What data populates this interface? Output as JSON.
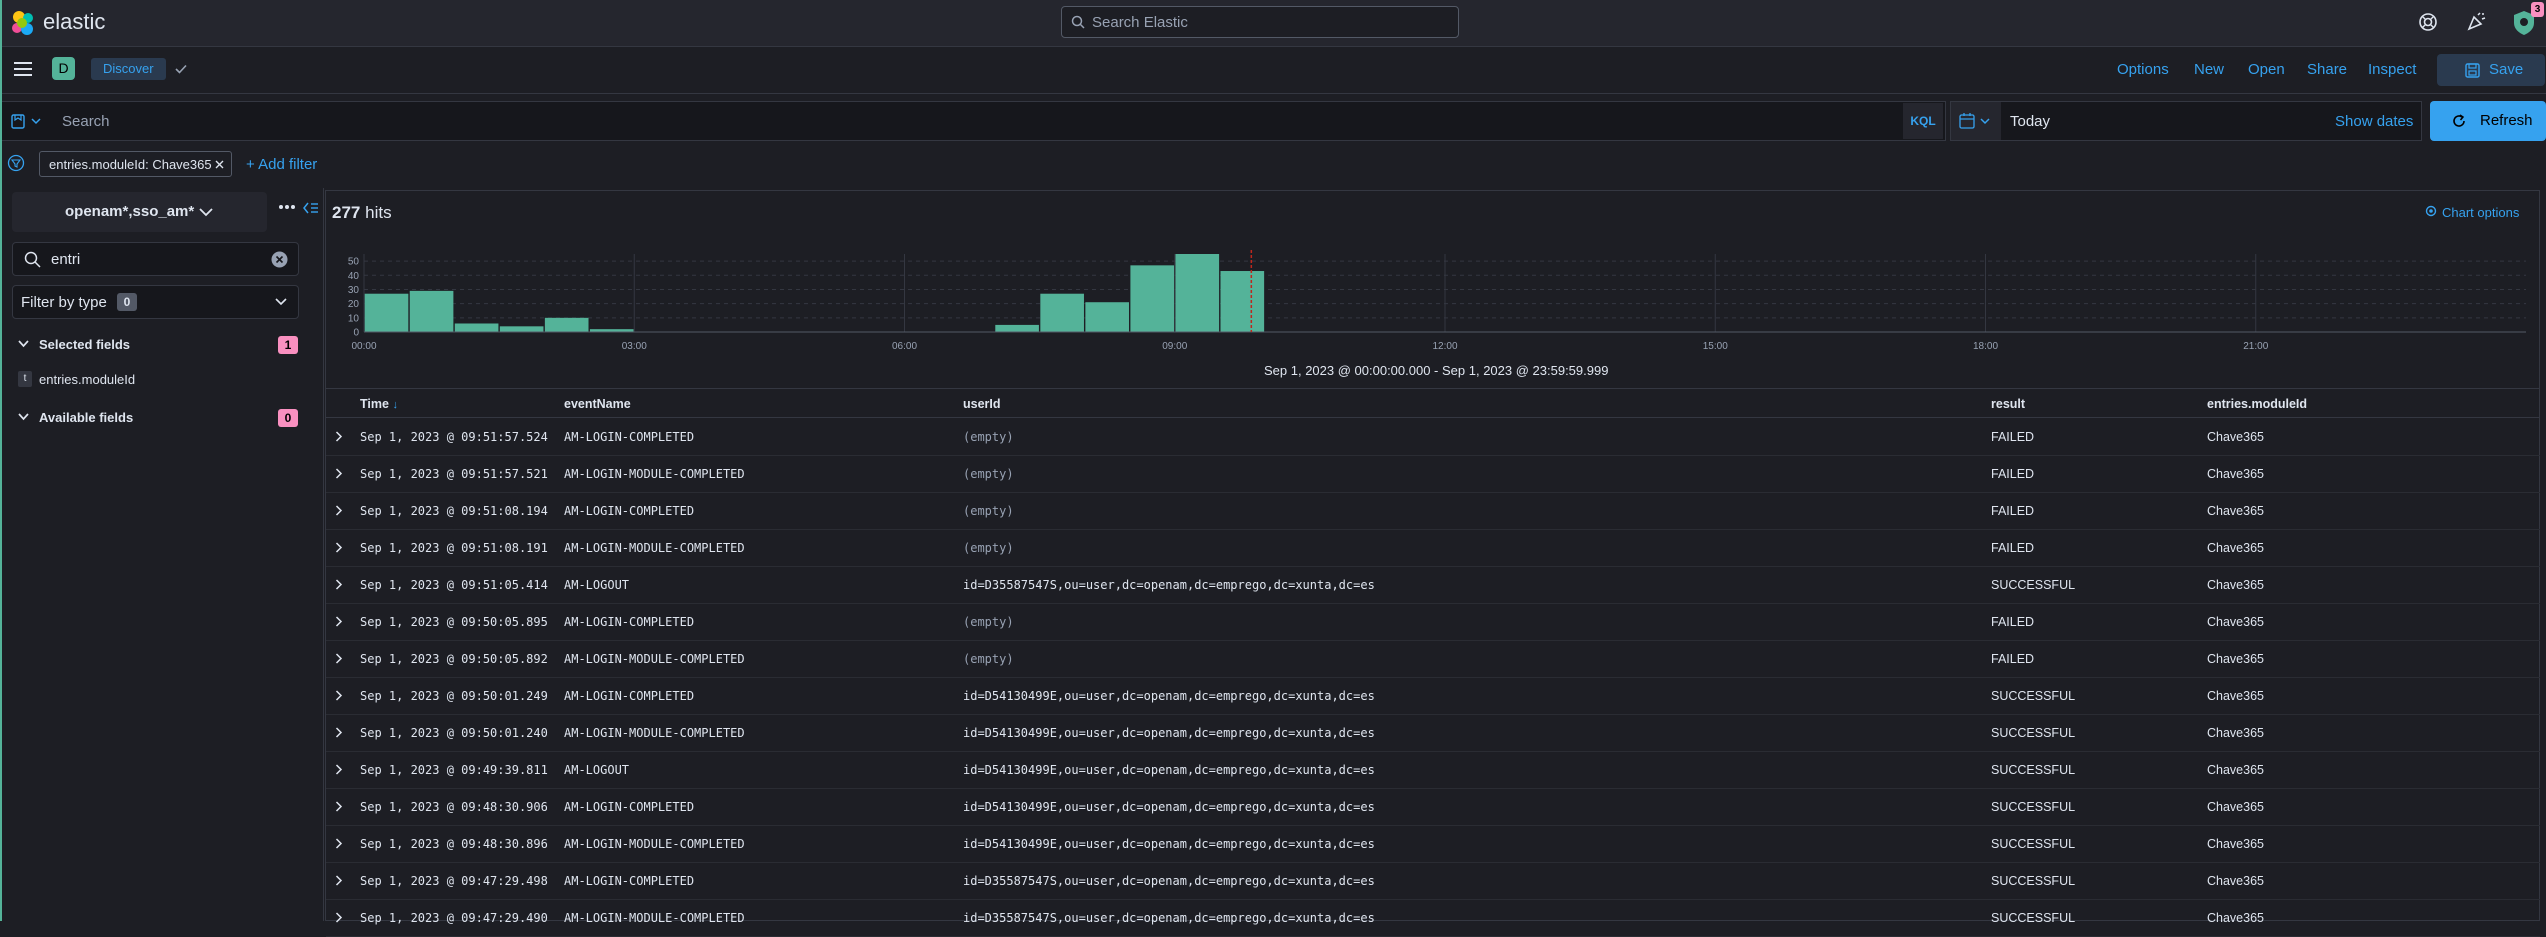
{
  "header": {
    "brand": "elastic",
    "global_search_placeholder": "Search Elastic",
    "notification_count": "3"
  },
  "subheader": {
    "space_letter": "D",
    "breadcrumb": "Discover",
    "links": [
      "Options",
      "New",
      "Open",
      "Share",
      "Inspect"
    ],
    "save_label": "Save"
  },
  "query": {
    "placeholder": "Search",
    "language": "KQL",
    "date": "Today",
    "show_dates": "Show dates",
    "refresh_label": "Refresh"
  },
  "filters": {
    "pill": "entries.moduleId: Chave365",
    "add_filter": "+ Add filter"
  },
  "sidebar": {
    "index_pattern": "openam*,sso_am*",
    "field_search_value": "entri",
    "filter_by_type": "Filter by type",
    "filter_by_type_count": "0",
    "selected_fields_title": "Selected fields",
    "selected_fields_count": "1",
    "selected_fields": [
      {
        "type": "t",
        "name": "entries.moduleId"
      }
    ],
    "available_fields_title": "Available fields",
    "available_fields_count": "0"
  },
  "results": {
    "hits_count": "277",
    "hits_label": "hits",
    "chart_options": "Chart options",
    "range_label": "Sep 1, 2023 @ 00:00:00.000 - Sep 1, 2023 @ 23:59:59.999"
  },
  "chart_data": {
    "type": "bar",
    "x_tick_labels": [
      "00:00",
      "03:00",
      "06:00",
      "09:00",
      "12:00",
      "15:00",
      "18:00",
      "21:00"
    ],
    "y_tick_labels": [
      "0",
      "10",
      "20",
      "30",
      "40",
      "50"
    ],
    "ylim": [
      0,
      55
    ],
    "bucket_minutes": 30,
    "buckets": [
      {
        "start": "00:00",
        "value": 27
      },
      {
        "start": "00:30",
        "value": 29
      },
      {
        "start": "01:00",
        "value": 6
      },
      {
        "start": "01:30",
        "value": 4
      },
      {
        "start": "02:00",
        "value": 10
      },
      {
        "start": "02:30",
        "value": 2
      },
      {
        "start": "07:00",
        "value": 5
      },
      {
        "start": "07:30",
        "value": 27
      },
      {
        "start": "08:00",
        "value": 21
      },
      {
        "start": "08:30",
        "value": 47
      },
      {
        "start": "09:00",
        "value": 55
      },
      {
        "start": "09:30",
        "value": 43
      }
    ],
    "bar_color": "#54b399",
    "now_marker": "09:51",
    "grid": true
  },
  "table": {
    "columns": [
      "Time",
      "eventName",
      "userId",
      "result",
      "entries.moduleId"
    ],
    "rows": [
      {
        "time": "Sep 1, 2023 @ 09:51:57.524",
        "event": "AM-LOGIN-COMPLETED",
        "user": "(empty)",
        "result": "FAILED",
        "module": "Chave365"
      },
      {
        "time": "Sep 1, 2023 @ 09:51:57.521",
        "event": "AM-LOGIN-MODULE-COMPLETED",
        "user": "(empty)",
        "result": "FAILED",
        "module": "Chave365"
      },
      {
        "time": "Sep 1, 2023 @ 09:51:08.194",
        "event": "AM-LOGIN-COMPLETED",
        "user": "(empty)",
        "result": "FAILED",
        "module": "Chave365"
      },
      {
        "time": "Sep 1, 2023 @ 09:51:08.191",
        "event": "AM-LOGIN-MODULE-COMPLETED",
        "user": "(empty)",
        "result": "FAILED",
        "module": "Chave365"
      },
      {
        "time": "Sep 1, 2023 @ 09:51:05.414",
        "event": "AM-LOGOUT",
        "user": "id=D35587547S,ou=user,dc=openam,dc=emprego,dc=xunta,dc=es",
        "result": "SUCCESSFUL",
        "module": "Chave365"
      },
      {
        "time": "Sep 1, 2023 @ 09:50:05.895",
        "event": "AM-LOGIN-COMPLETED",
        "user": "(empty)",
        "result": "FAILED",
        "module": "Chave365"
      },
      {
        "time": "Sep 1, 2023 @ 09:50:05.892",
        "event": "AM-LOGIN-MODULE-COMPLETED",
        "user": "(empty)",
        "result": "FAILED",
        "module": "Chave365"
      },
      {
        "time": "Sep 1, 2023 @ 09:50:01.249",
        "event": "AM-LOGIN-COMPLETED",
        "user": "id=D54130499E,ou=user,dc=openam,dc=emprego,dc=xunta,dc=es",
        "result": "SUCCESSFUL",
        "module": "Chave365"
      },
      {
        "time": "Sep 1, 2023 @ 09:50:01.240",
        "event": "AM-LOGIN-MODULE-COMPLETED",
        "user": "id=D54130499E,ou=user,dc=openam,dc=emprego,dc=xunta,dc=es",
        "result": "SUCCESSFUL",
        "module": "Chave365"
      },
      {
        "time": "Sep 1, 2023 @ 09:49:39.811",
        "event": "AM-LOGOUT",
        "user": "id=D54130499E,ou=user,dc=openam,dc=emprego,dc=xunta,dc=es",
        "result": "SUCCESSFUL",
        "module": "Chave365"
      },
      {
        "time": "Sep 1, 2023 @ 09:48:30.906",
        "event": "AM-LOGIN-COMPLETED",
        "user": "id=D54130499E,ou=user,dc=openam,dc=emprego,dc=xunta,dc=es",
        "result": "SUCCESSFUL",
        "module": "Chave365"
      },
      {
        "time": "Sep 1, 2023 @ 09:48:30.896",
        "event": "AM-LOGIN-MODULE-COMPLETED",
        "user": "id=D54130499E,ou=user,dc=openam,dc=emprego,dc=xunta,dc=es",
        "result": "SUCCESSFUL",
        "module": "Chave365"
      },
      {
        "time": "Sep 1, 2023 @ 09:47:29.498",
        "event": "AM-LOGIN-COMPLETED",
        "user": "id=D35587547S,ou=user,dc=openam,dc=emprego,dc=xunta,dc=es",
        "result": "SUCCESSFUL",
        "module": "Chave365"
      },
      {
        "time": "Sep 1, 2023 @ 09:47:29.490",
        "event": "AM-LOGIN-MODULE-COMPLETED",
        "user": "id=D35587547S,ou=user,dc=openam,dc=emprego,dc=xunta,dc=es",
        "result": "SUCCESSFUL",
        "module": "Chave365"
      }
    ]
  },
  "colors": {
    "accent": "#36a2ef",
    "bar": "#54b399",
    "badge_pink": "#f990c0",
    "now_marker": "#bd271e"
  }
}
